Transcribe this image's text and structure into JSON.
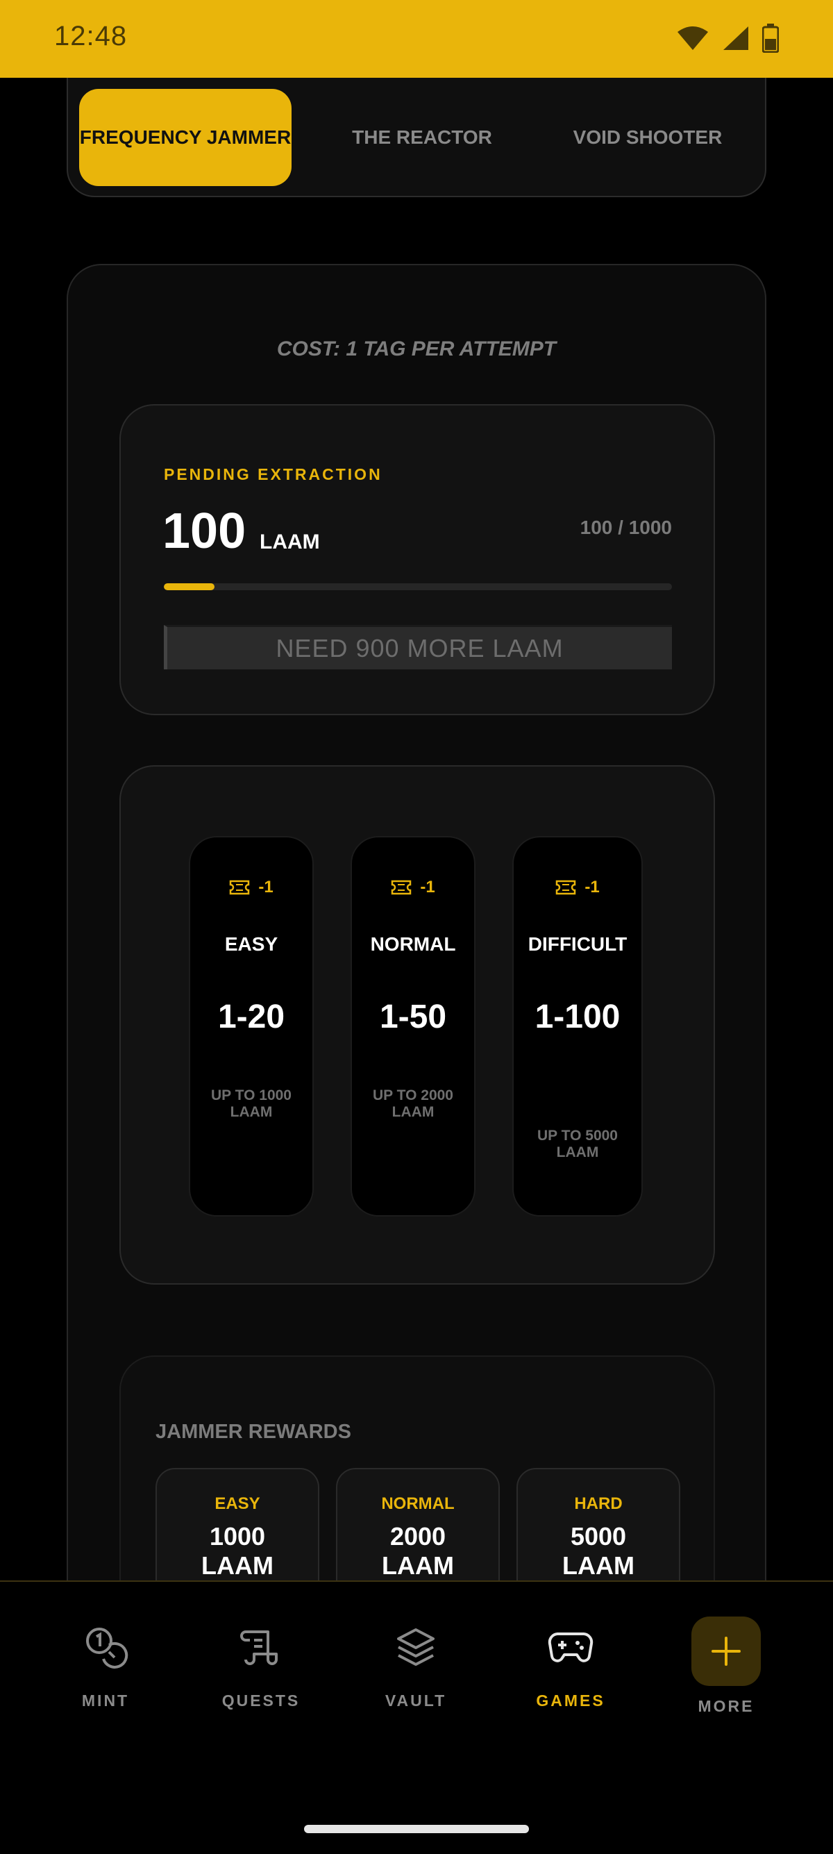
{
  "status_bar": {
    "time": "12:48"
  },
  "tabs": [
    {
      "label": "FREQUENCY JAMMER",
      "active": true
    },
    {
      "label": "THE REACTOR",
      "active": false
    },
    {
      "label": "VOID SHOOTER",
      "active": false
    }
  ],
  "main": {
    "cost_text": "COST: 1 TAG PER ATTEMPT",
    "extraction": {
      "label": "PENDING EXTRACTION",
      "amount": "100",
      "unit": "LAAM",
      "progress_text": "100 / 1000",
      "progress_fraction": 0.1,
      "action_label": "NEED 900 MORE LAAM"
    },
    "difficulties": [
      {
        "ticket_cost": "-1",
        "name": "EASY",
        "range": "1-20",
        "reward": "UP TO 1000 LAAM"
      },
      {
        "ticket_cost": "-1",
        "name": "NORMAL",
        "range": "1-50",
        "reward": "UP TO 2000 LAAM"
      },
      {
        "ticket_cost": "-1",
        "name": "DIFFICULT",
        "range": "1-100",
        "reward": "UP TO 5000 LAAM"
      }
    ],
    "rewards": {
      "title": "JAMMER REWARDS",
      "items": [
        {
          "label": "EASY",
          "value": "1000 LAAM"
        },
        {
          "label": "NORMAL",
          "value": "2000 LAAM"
        },
        {
          "label": "HARD",
          "value": "5000 LAAM"
        }
      ]
    }
  },
  "bottom_nav": [
    {
      "label": "MINT",
      "icon": "coins-icon",
      "active": false
    },
    {
      "label": "QUESTS",
      "icon": "scroll-icon",
      "active": false
    },
    {
      "label": "VAULT",
      "icon": "layers-icon",
      "active": false
    },
    {
      "label": "GAMES",
      "icon": "gamepad-icon",
      "active": true
    },
    {
      "label": "MORE",
      "icon": "plus-icon",
      "active": false
    }
  ],
  "colors": {
    "accent": "#e9b50b",
    "background": "#000000",
    "muted": "#8b8b8b"
  }
}
